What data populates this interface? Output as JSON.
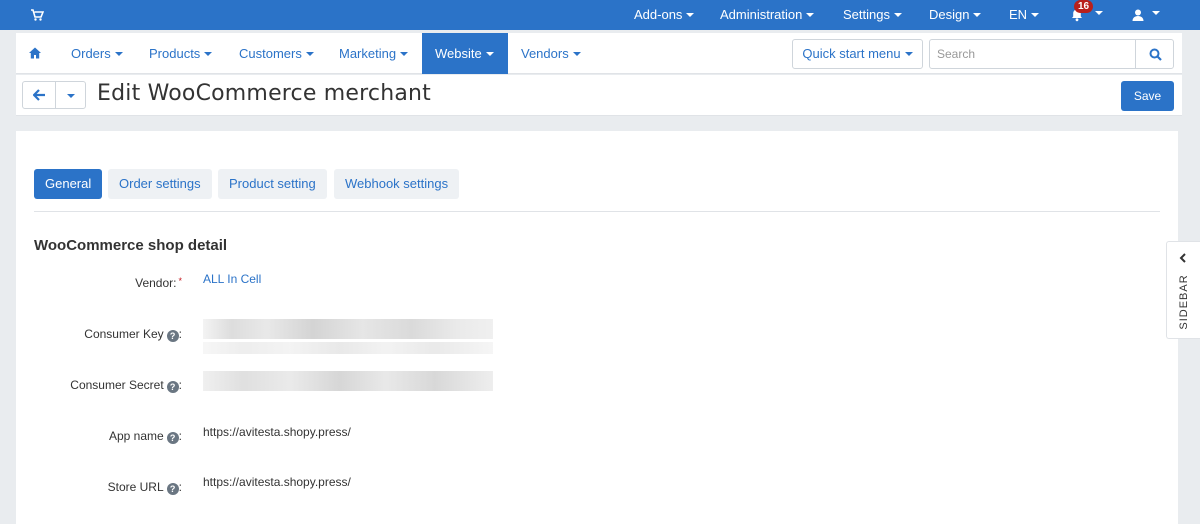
{
  "topbar": {
    "menus": [
      {
        "label": "Add-ons"
      },
      {
        "label": "Administration"
      },
      {
        "label": "Settings"
      },
      {
        "label": "Design"
      },
      {
        "label": "EN"
      }
    ],
    "notifications_count": "16"
  },
  "nav": {
    "items": [
      {
        "label": "Orders"
      },
      {
        "label": "Products"
      },
      {
        "label": "Customers"
      },
      {
        "label": "Marketing"
      },
      {
        "label": "Website"
      },
      {
        "label": "Vendors"
      }
    ],
    "active": "Website",
    "quick_start": "Quick start menu",
    "search_placeholder": "Search"
  },
  "header": {
    "title": "Edit WooCommerce merchant",
    "save_label": "Save"
  },
  "tabs": [
    {
      "label": "General"
    },
    {
      "label": "Order settings"
    },
    {
      "label": "Product setting"
    },
    {
      "label": "Webhook settings"
    }
  ],
  "active_tab": "General",
  "section": {
    "title": "WooCommerce shop detail"
  },
  "fields": {
    "vendor": {
      "label": "Vendor:",
      "required_mark": "*",
      "value": "ALL In Cell"
    },
    "consumer_key": {
      "label": "Consumer Key",
      "help": "?",
      "suffix": ":"
    },
    "consumer_secret": {
      "label": "Consumer Secret",
      "help": "?",
      "suffix": ":"
    },
    "app_name": {
      "label": "App name",
      "help": "?",
      "suffix": ":",
      "value": "https://avitesta.shopy.press/"
    },
    "store_url": {
      "label": "Store URL",
      "help": "?",
      "suffix": ":",
      "value": "https://avitesta.shopy.press/"
    }
  },
  "sidebar": {
    "label": "SIDEBAR"
  },
  "colors": {
    "accent": "#2b73c8",
    "badge": "#b8201c",
    "required": "#c4181e"
  }
}
